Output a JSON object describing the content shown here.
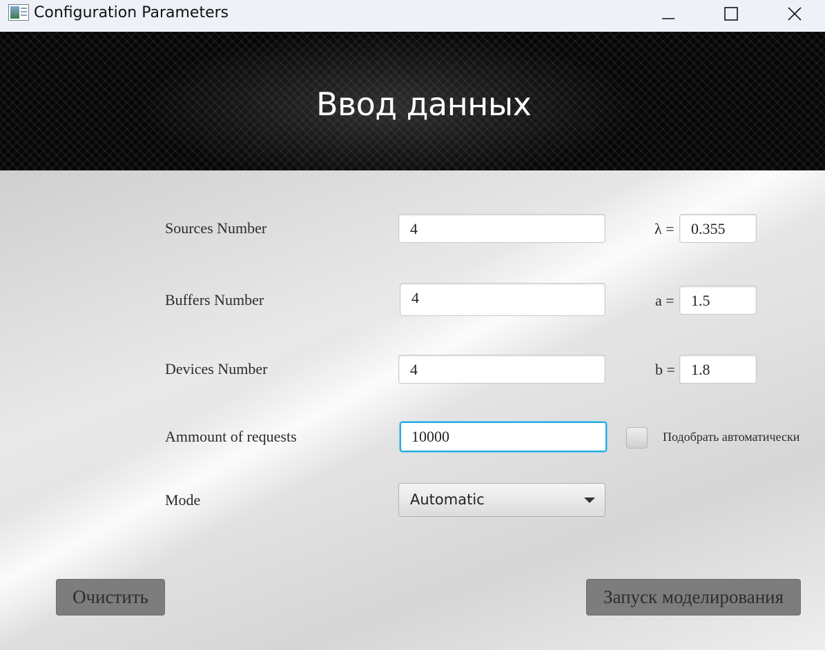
{
  "window": {
    "title": "Configuration Parameters",
    "app_icon": "app-icon",
    "controls": [
      "minimize-icon",
      "maximize-icon",
      "close-icon"
    ]
  },
  "banner": {
    "title": "Ввод данных"
  },
  "form": {
    "sources": {
      "label": "Sources Number",
      "value": "4",
      "param_label": "λ =",
      "param_value": "0.355"
    },
    "buffers": {
      "label": "Buffers Number",
      "value": "4",
      "param_label": "a =",
      "param_value": "1.5"
    },
    "devices": {
      "label": "Devices Number",
      "value": "4",
      "param_label": "b =",
      "param_value": "1.8"
    },
    "requests": {
      "label": "Ammount of requests",
      "value": "10000",
      "auto_label": "Подобрать автоматически",
      "auto_checked": false
    },
    "mode": {
      "label": "Mode",
      "selected": "Automatic"
    }
  },
  "buttons": {
    "clear": "Очистить",
    "run": "Запуск моделирования"
  },
  "colors": {
    "focus": "#24a9df",
    "button": "#7d7d7d",
    "banner": "#060606"
  }
}
